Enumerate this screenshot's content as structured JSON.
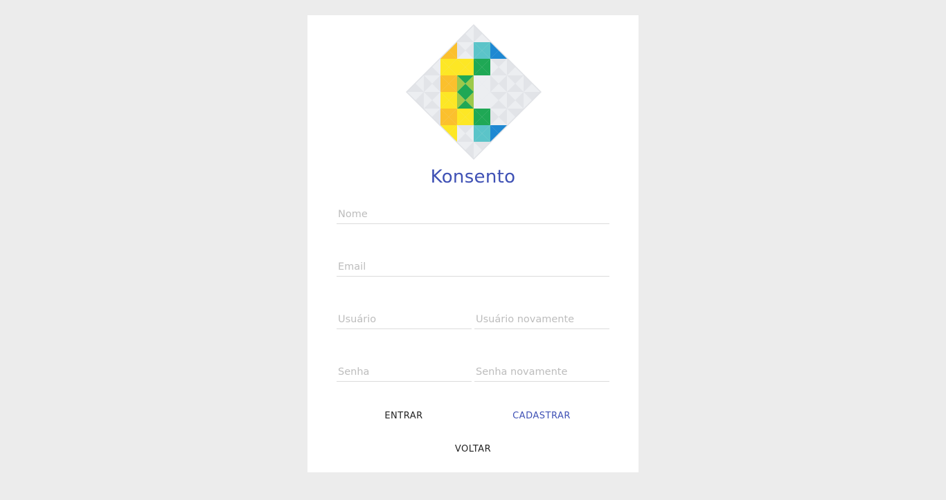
{
  "brand": {
    "name": "Konsento",
    "color": "#3f51b5"
  },
  "logo": {
    "icon": "konsento-diamond-logo",
    "colors": {
      "yellow": "#fde725",
      "orange": "#fbc02d",
      "green": "#1fa855",
      "lime": "#9dc94a",
      "teal": "#5bc4c9",
      "blue": "#1e88d2",
      "indigo": "#3d3f9a",
      "light_gray": "#eceef1",
      "gray": "#e2e4e8"
    }
  },
  "form": {
    "name_placeholder": "Nome",
    "email_placeholder": "Email",
    "user_placeholder": "Usuário",
    "user_confirm_placeholder": "Usuário novamente",
    "password_placeholder": "Senha",
    "password_confirm_placeholder": "Senha novamente"
  },
  "actions": {
    "login_label": "ENTRAR",
    "register_label": "CADASTRAR",
    "back_label": "VOLTAR"
  }
}
